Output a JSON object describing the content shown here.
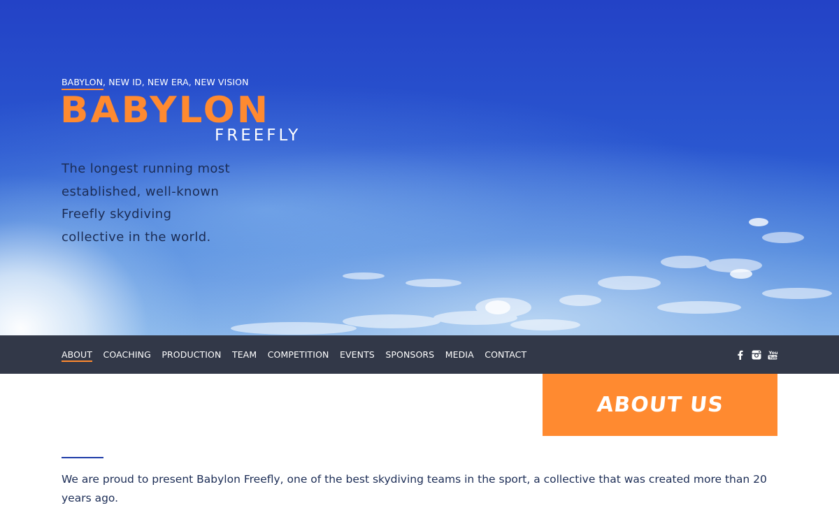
{
  "hero": {
    "tagline": "BABYLON, NEW ID, NEW ERA, NEW VISION",
    "logo_main": "BABYLON",
    "logo_sub": "FREEFLY",
    "intro": "The longest running most established, well-known Freefly skydiving collective in the world."
  },
  "nav": {
    "items": [
      {
        "label": "ABOUT",
        "active": true
      },
      {
        "label": "COACHING"
      },
      {
        "label": "PRODUCTION"
      },
      {
        "label": "TEAM"
      },
      {
        "label": "COMPETITION"
      },
      {
        "label": "EVENTS"
      },
      {
        "label": "SPONSORS"
      },
      {
        "label": "MEDIA"
      },
      {
        "label": "CONTACT"
      }
    ],
    "social": [
      "facebook-icon",
      "instagram-icon",
      "youtube-icon"
    ]
  },
  "about": {
    "title": "ABOUT US",
    "text": "We are proud to present Babylon Freefly, one of the best skydiving teams in the sport, a collective that was created more than 20 years ago."
  },
  "colors": {
    "accent": "#ff8a30",
    "navbar": "#323848",
    "text_dark": "#1b2c55",
    "sky": "#2342c6"
  }
}
